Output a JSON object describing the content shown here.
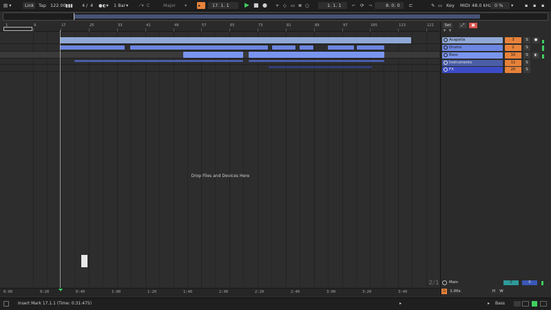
{
  "toolbar": {
    "link": "Link",
    "tap": "Tap",
    "tempo": "122.00",
    "time_sig_num": "4",
    "time_sig_sep": "/",
    "time_sig_den": "4",
    "quantize": "1 Bar",
    "key_root": "C",
    "key_scale": "Major",
    "arrangement_position": "17.   1.   1",
    "loop_start": "1.   1.   1",
    "loop_length": "8.   0.   0",
    "key_label": "Key",
    "midi_label": "MIDI",
    "sample_rate": "48.0 kHz",
    "cpu": "0 %"
  },
  "ruler": {
    "bars": [
      "1",
      "9",
      "17",
      "25",
      "33",
      "41",
      "49",
      "57",
      "65",
      "73",
      "81",
      "89",
      "97",
      "105",
      "113",
      "121"
    ]
  },
  "timeline": {
    "times": [
      "0:00",
      "0:20",
      "0:40",
      "1:00",
      "1:20",
      "1:40",
      "2:00",
      "2:20",
      "2:40",
      "3:00",
      "3:20",
      "3:40"
    ]
  },
  "arrangement": {
    "drop_hint": "Drop Files and Devices Here"
  },
  "mixer": {
    "set_label": "Set",
    "tracks": [
      {
        "name": "Acapella",
        "value": "3",
        "solo": "S",
        "color": "#8fa8d6",
        "extra": "●"
      },
      {
        "name": "Drums",
        "value": "2",
        "solo": "S",
        "color": "#6b86e0",
        "extra": ""
      },
      {
        "name": "Bass",
        "value": "10",
        "solo": "S",
        "color": "#7a95ef",
        "extra": "◐"
      },
      {
        "name": "Instruments",
        "value": "11",
        "solo": "S",
        "color": "#4a5ea8",
        "extra": ""
      },
      {
        "name": "FX",
        "value": "20",
        "solo": "S",
        "color": "#3c4cc8",
        "extra": ""
      }
    ],
    "main_label": "Main",
    "main_fraction": "2/1",
    "main_value_a": "0",
    "main_value_b": "0",
    "zoom": "1.00x",
    "h_label": "H",
    "w_label": "W"
  },
  "status": {
    "message": "Insert Mark 17.1.1 (Time: 0:31:475)",
    "track_name": "Bass"
  },
  "colors": {
    "accent_orange": "#e8823a",
    "play_green": "#3fcf5f",
    "clip_blue": "#7a95ef"
  }
}
